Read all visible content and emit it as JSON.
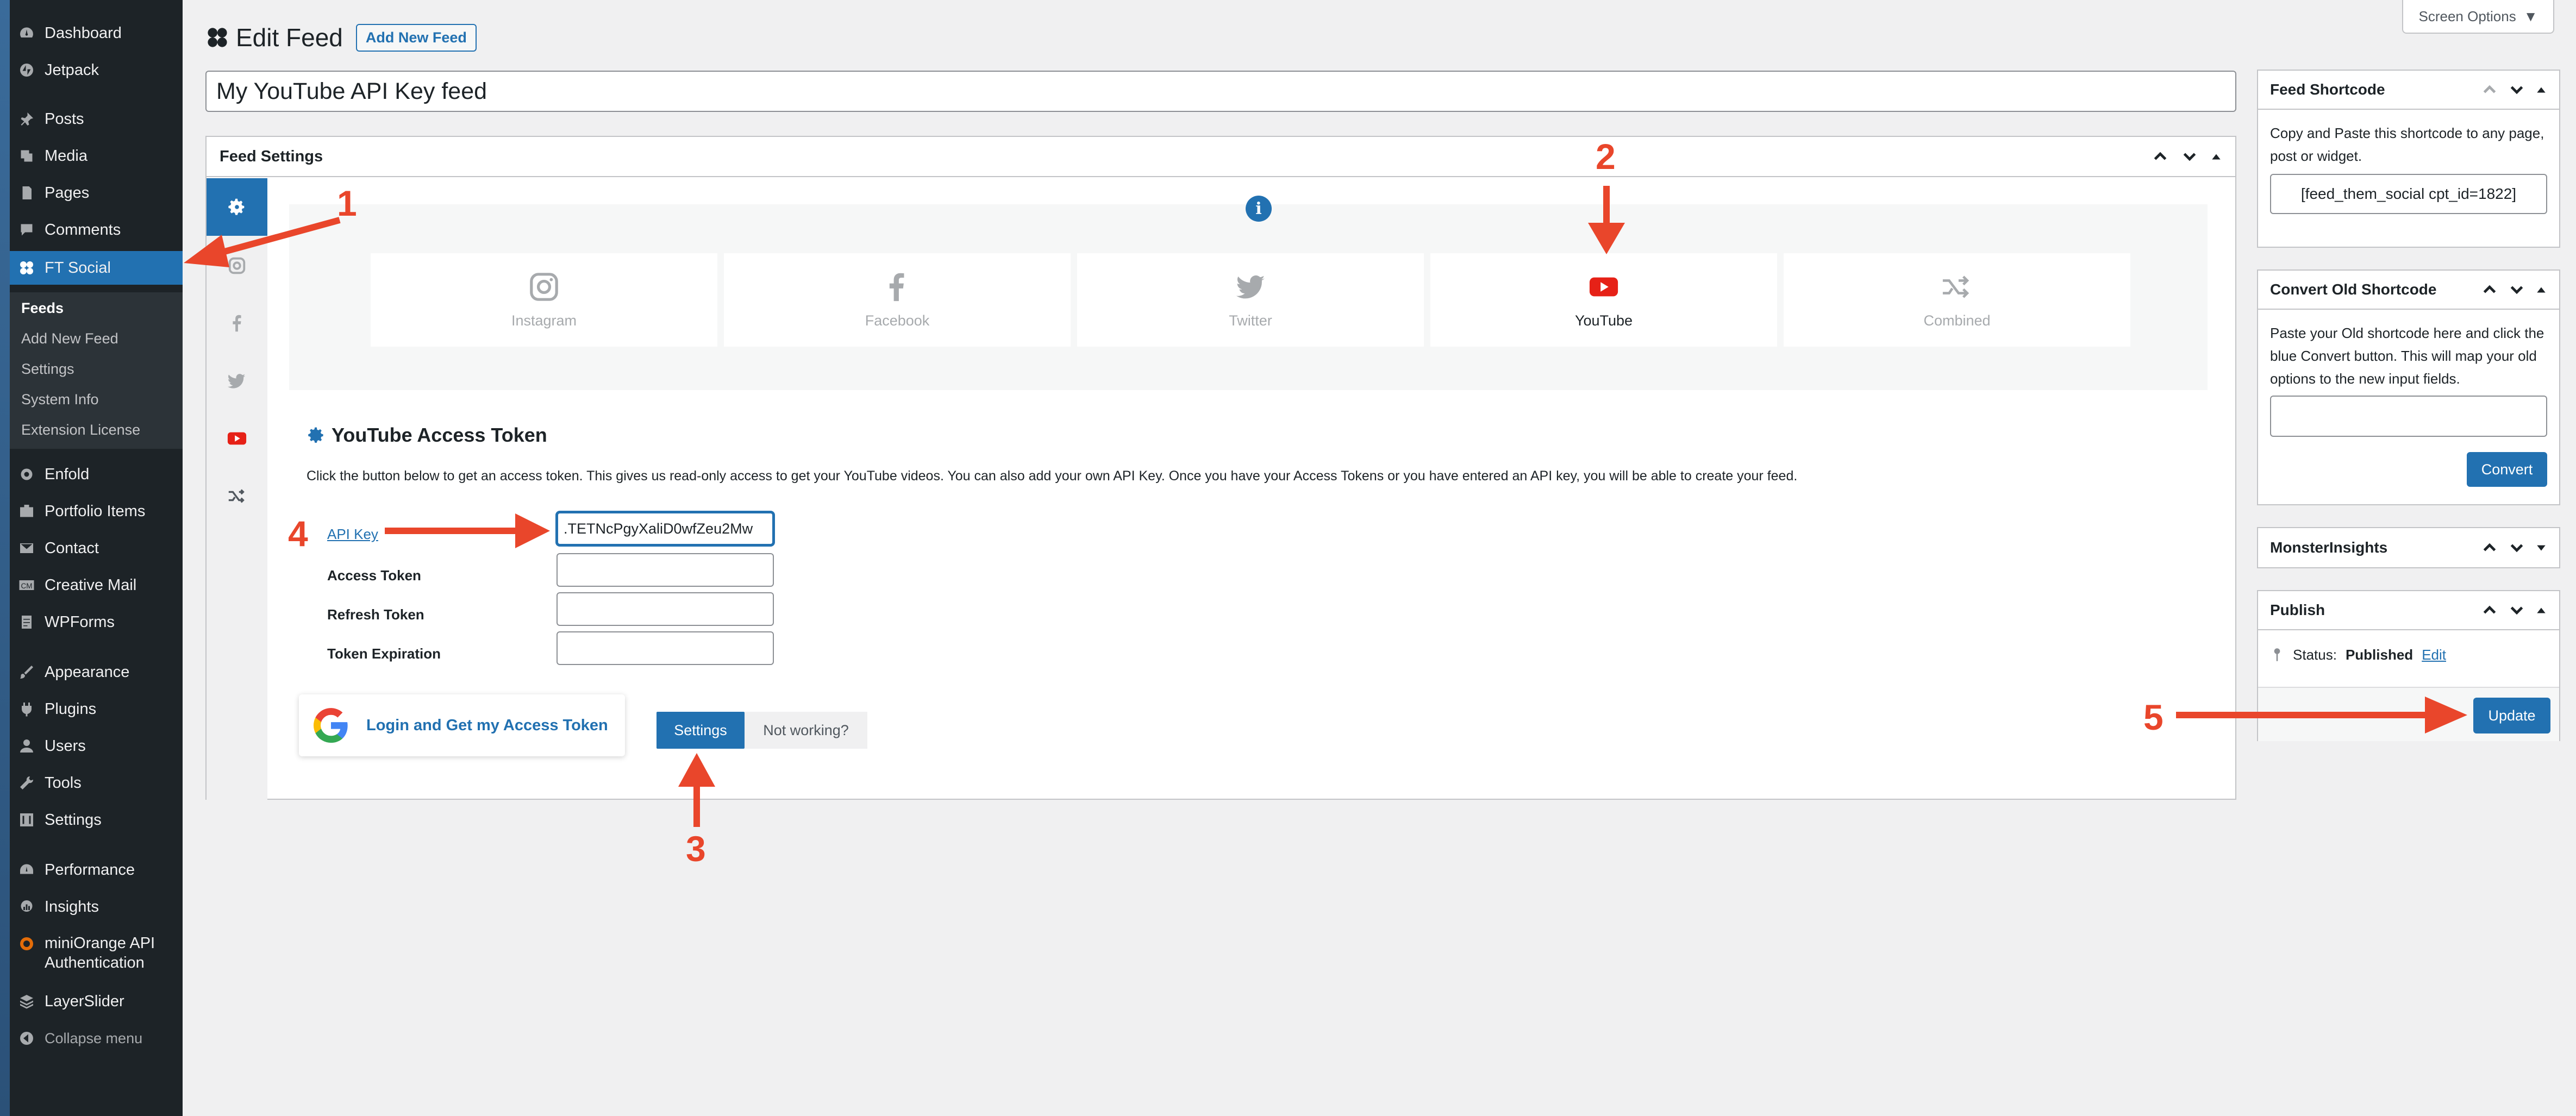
{
  "sidebar": {
    "items": [
      {
        "label": "Dashboard",
        "icon": "dashboard-icon"
      },
      {
        "label": "Jetpack",
        "icon": "jetpack-icon"
      },
      {
        "label": "Posts",
        "icon": "pin-icon"
      },
      {
        "label": "Media",
        "icon": "media-icon"
      },
      {
        "label": "Pages",
        "icon": "page-icon"
      },
      {
        "label": "Comments",
        "icon": "comment-icon"
      },
      {
        "label": "FT Social",
        "icon": "ft-social-icon"
      },
      {
        "label": "Enfold",
        "icon": "gear-icon"
      },
      {
        "label": "Portfolio Items",
        "icon": "portfolio-icon"
      },
      {
        "label": "Contact",
        "icon": "mail-icon"
      },
      {
        "label": "Creative Mail",
        "icon": "cm-icon"
      },
      {
        "label": "WPForms",
        "icon": "forms-icon"
      },
      {
        "label": "Appearance",
        "icon": "brush-icon"
      },
      {
        "label": "Plugins",
        "icon": "plugin-icon"
      },
      {
        "label": "Users",
        "icon": "user-icon"
      },
      {
        "label": "Tools",
        "icon": "wrench-icon"
      },
      {
        "label": "Settings",
        "icon": "settings-icon"
      },
      {
        "label": "Performance",
        "icon": "performance-icon"
      },
      {
        "label": "Insights",
        "icon": "insights-icon"
      },
      {
        "label": "miniOrange API Authentication",
        "icon": "miniorange-icon"
      },
      {
        "label": "LayerSlider",
        "icon": "layers-icon"
      }
    ],
    "submenu": [
      "Feeds",
      "Add New Feed",
      "Settings",
      "System Info",
      "Extension License"
    ],
    "collapse_label": "Collapse menu"
  },
  "header": {
    "title": "Edit Feed",
    "add_new_label": "Add New Feed",
    "screen_options": "Screen Options"
  },
  "post_title": "My YouTube API Key feed",
  "feed_settings": {
    "title": "Feed Settings",
    "feed_types": [
      "Instagram",
      "Facebook",
      "Twitter",
      "YouTube",
      "Combined"
    ],
    "selected_type": "YouTube",
    "section_title": "YouTube Access Token",
    "description": "Click the button below to get an access token. This gives us read-only access to get your YouTube videos. You can also add your own API Key. Once you have your Access Tokens or you have entered an API key, you will be able to create your feed.",
    "fields": [
      {
        "label": "API Key",
        "value": ".TETNcPgyXaliD0wfZeu2Mw"
      },
      {
        "label": "Access Token",
        "value": ""
      },
      {
        "label": "Refresh Token",
        "value": ""
      },
      {
        "label": "Token Expiration",
        "value": ""
      }
    ],
    "google_button": "Login and Get my Access Token",
    "settings_button": "Settings",
    "not_working_button": "Not working?"
  },
  "right": {
    "shortcode": {
      "title": "Feed Shortcode",
      "description": "Copy and Paste this shortcode to any page, post or widget.",
      "value": "[feed_them_social cpt_id=1822]"
    },
    "convert": {
      "title": "Convert Old Shortcode",
      "description": "Paste your Old shortcode here and click the blue Convert button. This will map your old options to the new input fields.",
      "button": "Convert"
    },
    "monsterinsights": {
      "title": "MonsterInsights"
    },
    "publish": {
      "title": "Publish",
      "status_label": "Status:",
      "status_value": "Published",
      "edit_label": "Edit",
      "update_button": "Update"
    }
  },
  "annotations": [
    "1",
    "2",
    "3",
    "4",
    "5"
  ],
  "colors": {
    "accent": "#2271b1",
    "annotation": "#e9462b",
    "sidebar": "#1d2327"
  }
}
